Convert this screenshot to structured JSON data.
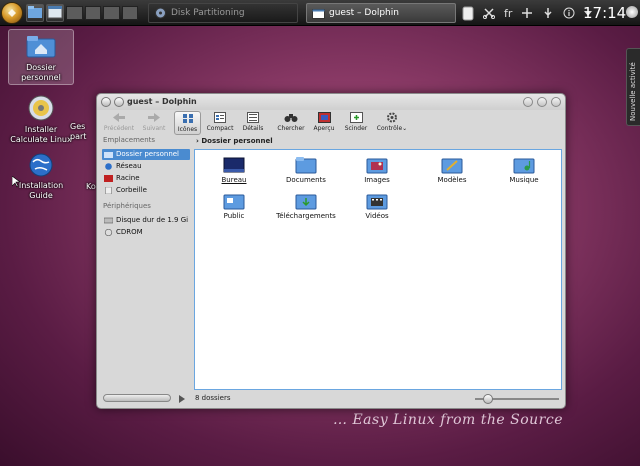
{
  "panel": {
    "tasks": [
      {
        "label": "Disk Partitioning"
      },
      {
        "label": "guest – Dolphin"
      }
    ],
    "keyboard_layout": "fr",
    "clock": "17:14"
  },
  "desktop": {
    "icons": [
      {
        "label": "Dossier personnel"
      },
      {
        "label": "Installer Calculate Linux"
      },
      {
        "label": "Ges part"
      },
      {
        "label": "Installation Guide"
      },
      {
        "label": "Ko"
      }
    ],
    "side_tab": "Nouvelle activité",
    "slogan": "… Easy Linux from the Source"
  },
  "window": {
    "title": "guest – Dolphin",
    "toolbar": [
      {
        "label": "Précédent",
        "icon": "back-arrow-icon",
        "enabled": false
      },
      {
        "label": "Suivant",
        "icon": "forward-arrow-icon",
        "enabled": false
      },
      {
        "label": "Icônes",
        "icon": "icons-view-icon",
        "active": true
      },
      {
        "label": "Compact",
        "icon": "compact-view-icon"
      },
      {
        "label": "Détails",
        "icon": "details-view-icon"
      },
      {
        "label": "Chercher",
        "icon": "binoculars-icon"
      },
      {
        "label": "Aperçu",
        "icon": "preview-icon"
      },
      {
        "label": "Scinder",
        "icon": "split-icon"
      },
      {
        "label": "Contrôle",
        "icon": "gear-icon"
      }
    ],
    "sidebar": {
      "places_heading": "Emplacements",
      "places": [
        {
          "label": "Dossier personnel",
          "selected": true
        },
        {
          "label": "Réseau"
        },
        {
          "label": "Racine"
        },
        {
          "label": "Corbeille"
        }
      ],
      "devices_heading": "Périphériques",
      "devices": [
        {
          "label": "Disque dur de 1.9 Gi"
        },
        {
          "label": "CDROM"
        }
      ]
    },
    "breadcrumb": "Dossier personnel",
    "files": [
      {
        "name": "Bureau",
        "color": "#1a2a6a"
      },
      {
        "name": "Documents"
      },
      {
        "name": "Images"
      },
      {
        "name": "Modèles"
      },
      {
        "name": "Musique"
      },
      {
        "name": "Public"
      },
      {
        "name": "Téléchargements"
      },
      {
        "name": "Vidéos"
      }
    ],
    "status": "8 dossiers"
  }
}
